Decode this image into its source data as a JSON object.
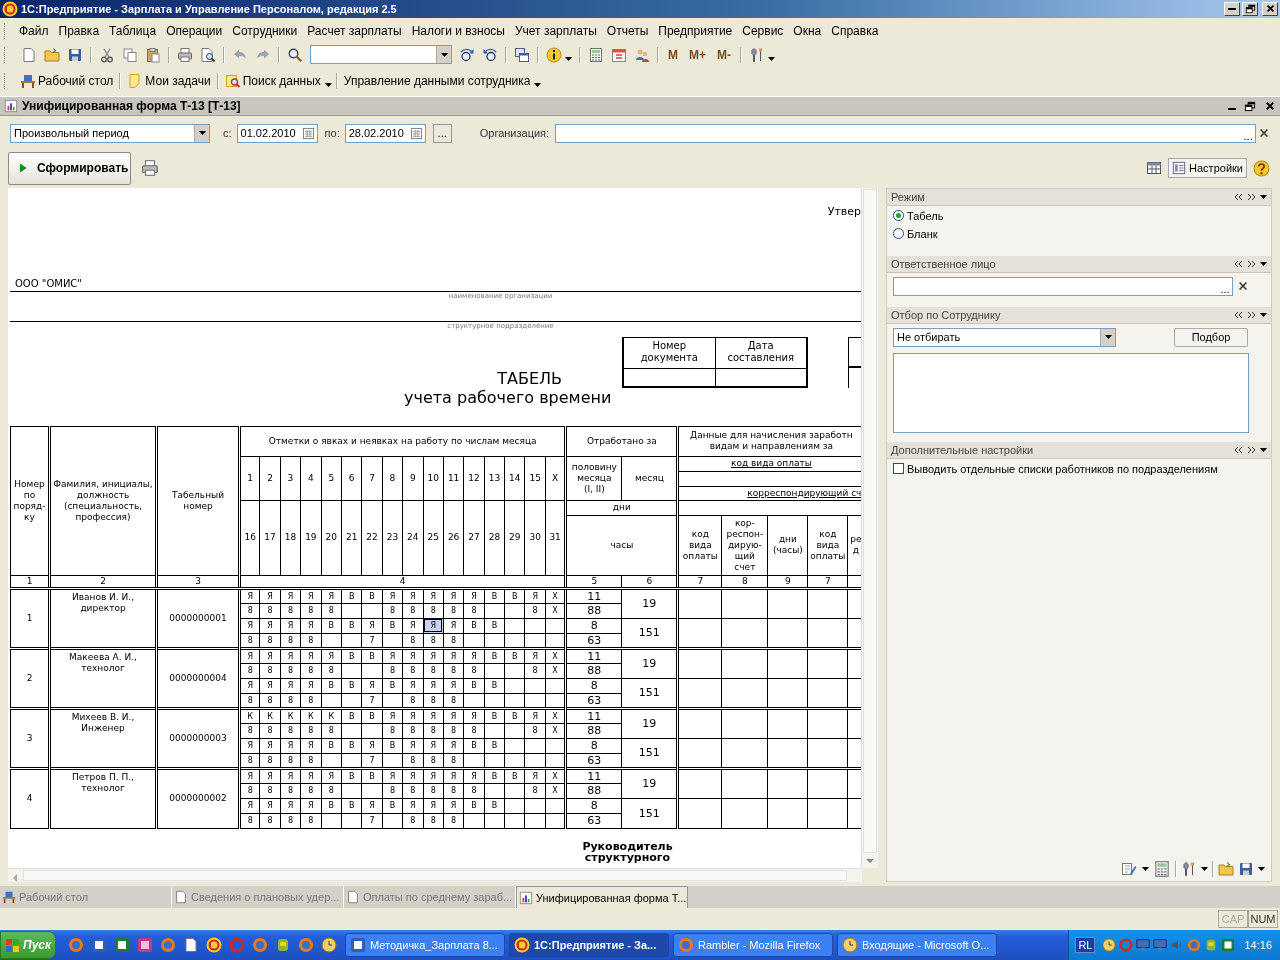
{
  "window": {
    "title": "1С:Предприятие - Зарплата и Управление Персоналом, редакция 2.5"
  },
  "menu": [
    "Файл",
    "Правка",
    "Таблица",
    "Операции",
    "Сотрудники",
    "Расчет зарплаты",
    "Налоги и взносы",
    "Учет зарплаты",
    "Отчеты",
    "Предприятие",
    "Сервис",
    "Окна",
    "Справка"
  ],
  "toolbar": {
    "memory_buttons": [
      "M",
      "M+",
      "M-"
    ]
  },
  "panels_toolbar": [
    {
      "label": "Рабочий стол",
      "dropdown": false
    },
    {
      "label": "Мои задачи",
      "dropdown": false
    },
    {
      "label": "Поиск данных",
      "dropdown": true
    },
    {
      "label": "Управление данными сотрудника",
      "dropdown": true
    }
  ],
  "form": {
    "title": "Унифицированная форма Т-13 [Т-13]",
    "period": "Произвольный период",
    "from": {
      "label": "с:",
      "value": "01.02.2010"
    },
    "to": {
      "label": "по:",
      "value": "28.02.2010"
    },
    "period_button": "...",
    "organization": {
      "label": "Организация:",
      "button": "..."
    },
    "generate_button": "Сформировать",
    "settings_button": "Настройки"
  },
  "report": {
    "approval": "Утвер",
    "organization": "ООО \"ОМИС\"",
    "organization_caption": "наименование организации",
    "department_caption": "структурное подразделение",
    "doc_headers": [
      "Номер документа",
      "Дата составления"
    ],
    "title": "ТАБЕЛЬ",
    "subtitle": "учета  рабочего времени",
    "table": {
      "col_number": "Номер\nпо\nпоряд-\nку",
      "col_name": "Фамилия, инициалы,\nдолжность\n(специальность,\nпрофессия)",
      "col_tab": "Табельный\nномер",
      "marks_title": "Отметки о явках и неявках на работу по числам месяца",
      "days_first": [
        "1",
        "2",
        "3",
        "4",
        "5",
        "6",
        "7",
        "8",
        "9",
        "10",
        "11",
        "12",
        "13",
        "14",
        "15",
        "Х"
      ],
      "days_second": [
        "16",
        "17",
        "18",
        "19",
        "20",
        "21",
        "22",
        "23",
        "24",
        "25",
        "26",
        "27",
        "28",
        "29",
        "30",
        "31"
      ],
      "worked_title": "Отработано за",
      "half_month": "половину\nмесяца\n(I, II)",
      "month": "месяц",
      "days": "дни",
      "hours": "часы",
      "pay_title": "Данные для начисления заработн\nвидам и направлениям за",
      "pay_code": "код вида оплаты",
      "corr_account": "корреспондирующий сч",
      "sub_columns": [
        "код\nвида\nоплаты",
        "кор-\nреспон-\nдирую-\nщий\nсчет",
        "дни\n(часы)",
        "код\nвида\nоплаты",
        "ре\nд"
      ],
      "column_numbers": [
        "1",
        "2",
        "3",
        "4",
        "5",
        "6",
        "7",
        "8",
        "9",
        "7"
      ],
      "employees": [
        {
          "number": "1",
          "name": "Иванов И. И., директор",
          "tab_number": "0000000001",
          "grid": [
            [
              "Я",
              "Я",
              "Я",
              "Я",
              "Я",
              "В",
              "В",
              "Я",
              "Я",
              "Я",
              "Я",
              "Я",
              "В",
              "В",
              "Я",
              "Х"
            ],
            [
              "8",
              "8",
              "8",
              "8",
              "8",
              {
                "kind": "blank"
              },
              {
                "kind": "blank"
              },
              "8",
              "8",
              "8",
              "8",
              "8",
              {
                "kind": "blank"
              },
              {
                "kind": "blank"
              },
              "8",
              "Х"
            ],
            [
              "Я",
              "Я",
              "Я",
              "Я",
              "В",
              "В",
              "Я",
              "В",
              "Я",
              {
                "text": "Я",
                "selected": true
              },
              "Я",
              "В",
              "В",
              {
                "kind": "blank"
              },
              {
                "kind": "blank"
              },
              {
                "kind": "blank"
              }
            ],
            [
              "8",
              "8",
              "8",
              "8",
              {
                "kind": "blank"
              },
              {
                "kind": "blank"
              },
              "7",
              {
                "kind": "blank"
              },
              "8",
              "8",
              "8",
              {
                "kind": "blank"
              },
              {
                "kind": "blank"
              },
              {
                "kind": "blank"
              },
              {
                "kind": "blank"
              },
              {
                "kind": "blank"
              }
            ]
          ],
          "half": [
            "11",
            "88",
            "8",
            "63"
          ],
          "month": [
            "19",
            "151"
          ]
        },
        {
          "number": "2",
          "name": "Макеева  А. И., технолог",
          "tab_number": "0000000004",
          "grid": [
            [
              "Я",
              "Я",
              "Я",
              "Я",
              "Я",
              "В",
              "В",
              "Я",
              "Я",
              "Я",
              "Я",
              "Я",
              "В",
              "В",
              "Я",
              "Х"
            ],
            [
              "8",
              "8",
              "8",
              "8",
              "8",
              {
                "kind": "blank"
              },
              {
                "kind": "blank"
              },
              "8",
              "8",
              "8",
              "8",
              "8",
              {
                "kind": "blank"
              },
              {
                "kind": "blank"
              },
              "8",
              "Х"
            ],
            [
              "Я",
              "Я",
              "Я",
              "Я",
              "В",
              "В",
              "Я",
              "В",
              "Я",
              "Я",
              "Я",
              "В",
              "В",
              {
                "kind": "blank"
              },
              {
                "kind": "blank"
              },
              {
                "kind": "blank"
              }
            ],
            [
              "8",
              "8",
              "8",
              "8",
              {
                "kind": "blank"
              },
              {
                "kind": "blank"
              },
              "7",
              {
                "kind": "blank"
              },
              "8",
              "8",
              "8",
              {
                "kind": "blank"
              },
              {
                "kind": "blank"
              },
              {
                "kind": "blank"
              },
              {
                "kind": "blank"
              },
              {
                "kind": "blank"
              }
            ]
          ],
          "half": [
            "11",
            "88",
            "8",
            "63"
          ],
          "month": [
            "19",
            "151"
          ]
        },
        {
          "number": "3",
          "name": "Михеев В. И., Инженер",
          "tab_number": "0000000003",
          "grid": [
            [
              "К",
              "К",
              "К",
              "К",
              "К",
              "В",
              "В",
              "Я",
              "Я",
              "Я",
              "Я",
              "Я",
              "В",
              "В",
              "Я",
              "Х"
            ],
            [
              "8",
              "8",
              "8",
              "8",
              "8",
              {
                "kind": "blank"
              },
              {
                "kind": "blank"
              },
              "8",
              "8",
              "8",
              "8",
              "8",
              {
                "kind": "blank"
              },
              {
                "kind": "blank"
              },
              "8",
              "Х"
            ],
            [
              "Я",
              "Я",
              "Я",
              "Я",
              "В",
              "В",
              "Я",
              "В",
              "Я",
              "Я",
              "Я",
              "В",
              "В",
              {
                "kind": "blank"
              },
              {
                "kind": "blank"
              },
              {
                "kind": "blank"
              }
            ],
            [
              "8",
              "8",
              "8",
              "8",
              {
                "kind": "blank"
              },
              {
                "kind": "blank"
              },
              "7",
              {
                "kind": "blank"
              },
              "8",
              "8",
              "8",
              {
                "kind": "blank"
              },
              {
                "kind": "blank"
              },
              {
                "kind": "blank"
              },
              {
                "kind": "blank"
              },
              {
                "kind": "blank"
              }
            ]
          ],
          "half": [
            "11",
            "88",
            "8",
            "63"
          ],
          "month": [
            "19",
            "151"
          ]
        },
        {
          "number": "4",
          "name": "Петров П. П., технолог",
          "tab_number": "0000000002",
          "grid": [
            [
              "Я",
              "Я",
              "Я",
              "Я",
              "Я",
              "В",
              "В",
              "Я",
              "Я",
              "Я",
              "Я",
              "Я",
              "В",
              "В",
              "Я",
              "Х"
            ],
            [
              "8",
              "8",
              "8",
              "8",
              "8",
              {
                "kind": "blank"
              },
              {
                "kind": "blank"
              },
              "8",
              "8",
              "8",
              "8",
              "8",
              {
                "kind": "blank"
              },
              {
                "kind": "blank"
              },
              "8",
              "Х"
            ],
            [
              "Я",
              "Я",
              "Я",
              "Я",
              "В",
              "В",
              "Я",
              "В",
              "Я",
              "Я",
              "Я",
              "В",
              "В",
              {
                "kind": "blank"
              },
              {
                "kind": "blank"
              },
              {
                "kind": "blank"
              }
            ],
            [
              "8",
              "8",
              "8",
              "8",
              {
                "kind": "blank"
              },
              {
                "kind": "blank"
              },
              "7",
              {
                "kind": "blank"
              },
              "8",
              "8",
              "8",
              {
                "kind": "blank"
              },
              {
                "kind": "blank"
              },
              {
                "kind": "blank"
              },
              {
                "kind": "blank"
              },
              {
                "kind": "blank"
              }
            ]
          ],
          "half": [
            "11",
            "88",
            "8",
            "63"
          ],
          "month": [
            "19",
            "151"
          ]
        }
      ]
    },
    "signature": "Руководитель\nструктурного"
  },
  "side_panel": {
    "sections": [
      {
        "kind": "radios",
        "title": "Режим",
        "options": [
          {
            "label": "Табель",
            "selected": true
          },
          {
            "label": "Бланк",
            "selected": false
          }
        ]
      },
      {
        "kind": "field",
        "title": "Ответственное лицо",
        "button": "..."
      },
      {
        "kind": "filter",
        "title": "Отбор по Сотруднику",
        "value": "Не отбирать",
        "button": "Подбор"
      },
      {
        "kind": "checks",
        "title": "Дополнительные настройки",
        "options": [
          {
            "label": "Выводить отдельные списки работников по подразделениям",
            "checked": false
          }
        ]
      }
    ]
  },
  "window_tabs": [
    {
      "label": "Рабочий стол",
      "selected": false
    },
    {
      "label": "Сведения о плановых удер...",
      "selected": false
    },
    {
      "label": "Оплаты по среднему зараб...",
      "selected": false
    },
    {
      "label": "Унифицированная форма Т...",
      "selected": true
    }
  ],
  "status_bar": [
    {
      "label": "CAP",
      "on": false
    },
    {
      "label": "NUM",
      "on": true
    }
  ],
  "taskbar": {
    "start": "Пуск",
    "tasks": [
      {
        "label": "Методичка_Зарплата 8...",
        "selected": false
      },
      {
        "label": "1С:Предприятие - За...",
        "selected": true
      },
      {
        "label": "Rambler - Mozilla Firefox",
        "selected": false
      },
      {
        "label": "Входящие - Microsoft O...",
        "selected": false
      }
    ],
    "language": "RL",
    "clock": "14:16"
  }
}
